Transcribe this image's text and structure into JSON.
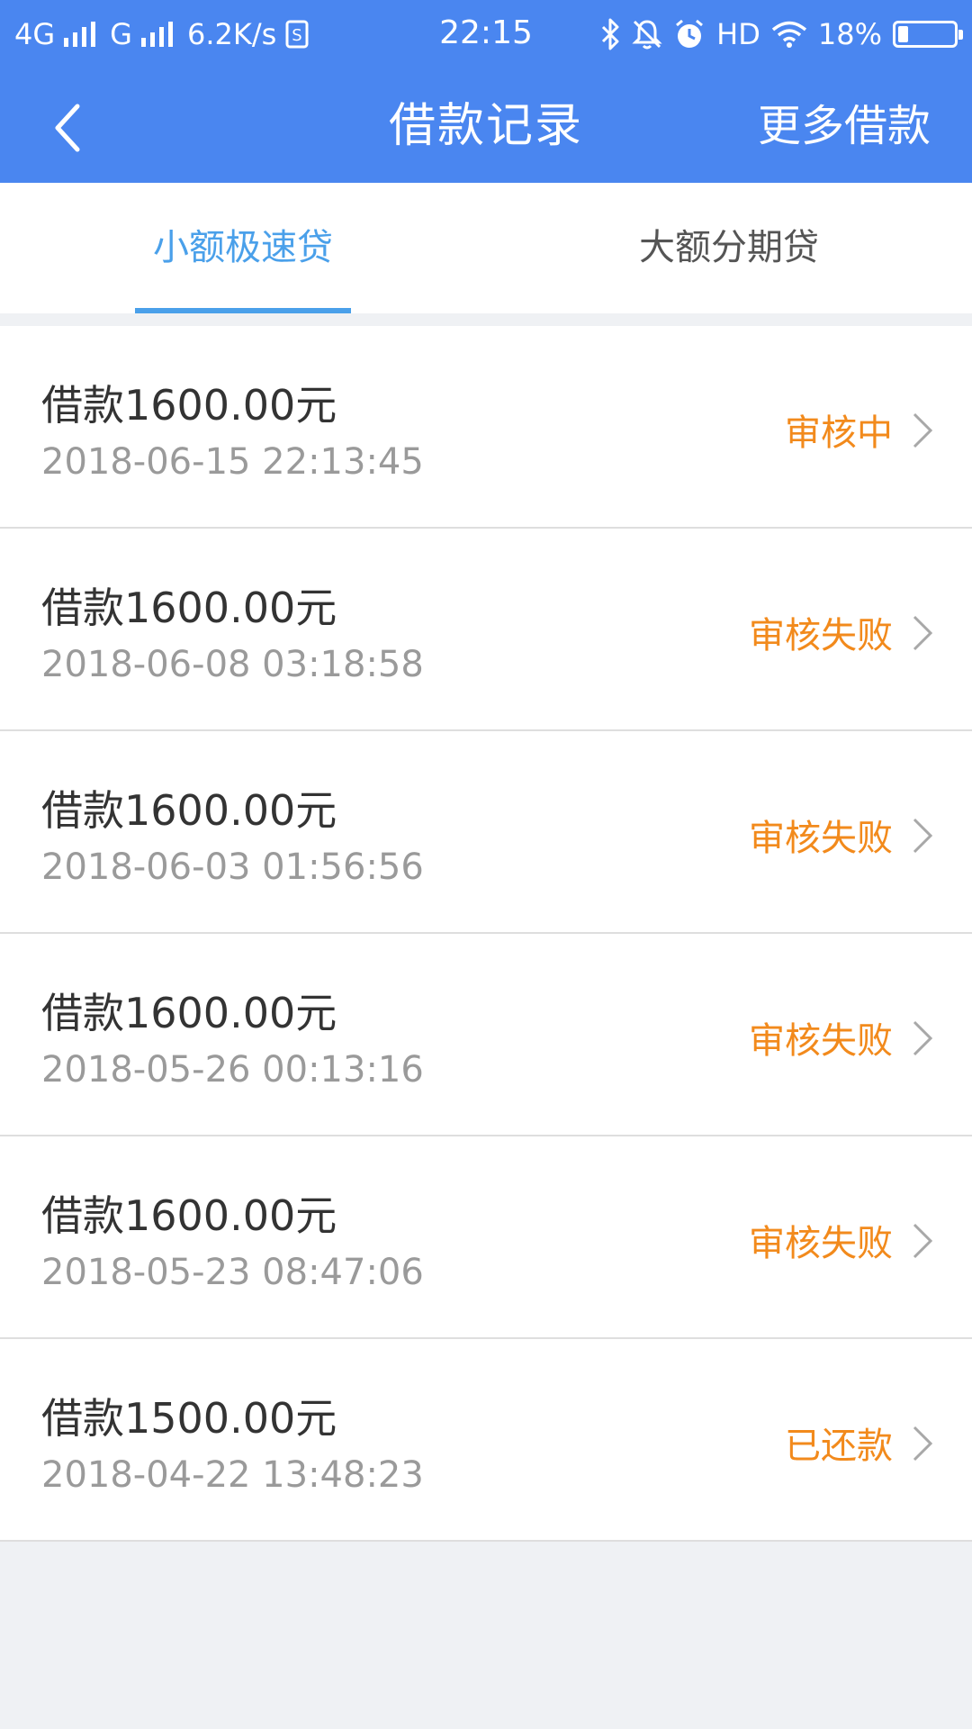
{
  "status_bar": {
    "network": "4G",
    "network2": "G",
    "speed": "6.2K/s",
    "time": "22:15",
    "hd": "HD",
    "battery": "18%",
    "battery_level": 0.18
  },
  "header": {
    "title": "借款记录",
    "more_label": "更多借款"
  },
  "tabs": [
    {
      "label": "小额极速贷",
      "active": true
    },
    {
      "label": "大额分期贷",
      "active": false
    }
  ],
  "records": [
    {
      "title": "借款1600.00元",
      "date": "2018-06-15 22:13:45",
      "status": "审核中"
    },
    {
      "title": "借款1600.00元",
      "date": "2018-06-08 03:18:58",
      "status": "审核失败"
    },
    {
      "title": "借款1600.00元",
      "date": "2018-06-03 01:56:56",
      "status": "审核失败"
    },
    {
      "title": "借款1600.00元",
      "date": "2018-05-26 00:13:16",
      "status": "审核失败"
    },
    {
      "title": "借款1600.00元",
      "date": "2018-05-23 08:47:06",
      "status": "审核失败"
    },
    {
      "title": "借款1500.00元",
      "date": "2018-04-22 13:48:23",
      "status": "已还款"
    }
  ],
  "colors": {
    "header_bg": "#4a86f0",
    "tab_active": "#4aa0ea",
    "status_text": "#f28a1c",
    "page_bg": "#eff1f4"
  },
  "icons": [
    "back-arrow-icon",
    "chevron-right-icon",
    "bluetooth-icon",
    "mute-bell-icon",
    "alarm-icon",
    "wifi-icon",
    "battery-icon",
    "sim-icon"
  ]
}
